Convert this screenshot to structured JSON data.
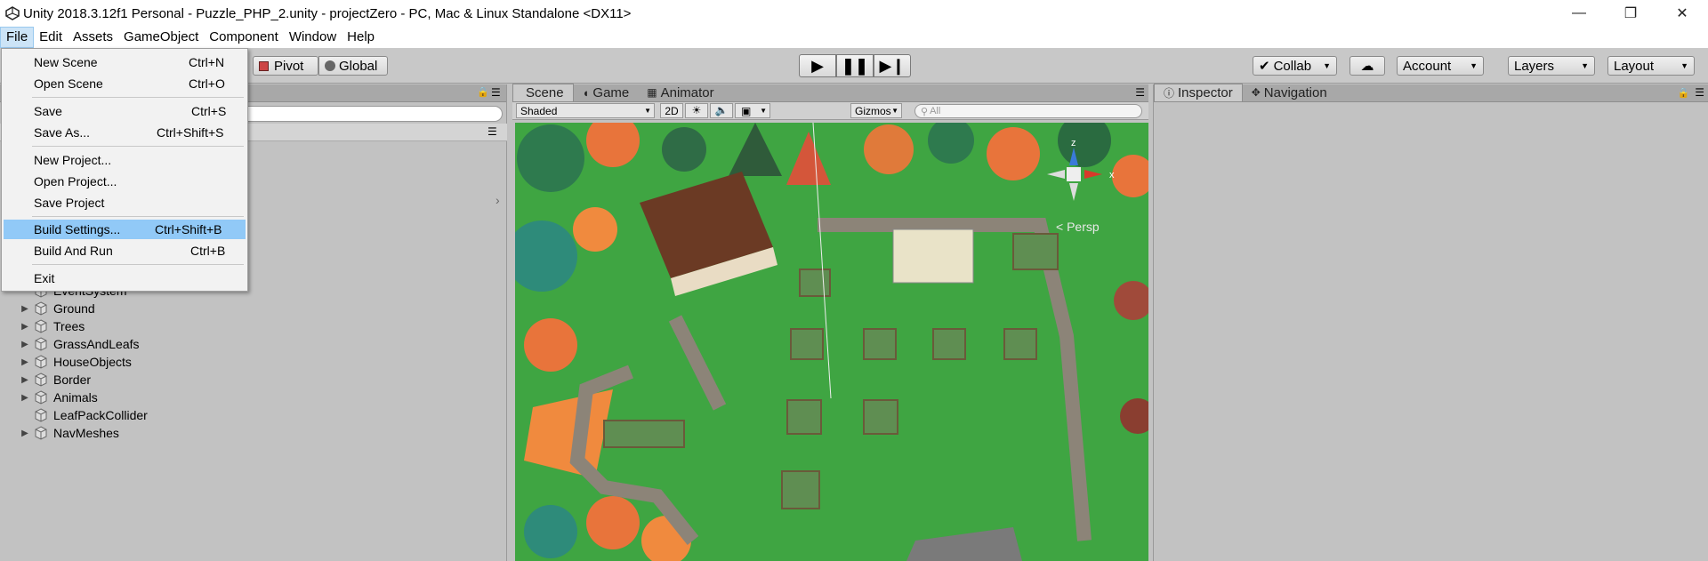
{
  "titlebar": {
    "title": "Unity 2018.3.12f1 Personal - Puzzle_PHP_2.unity - projectZero - PC, Mac & Linux Standalone <DX11>"
  },
  "menubar": {
    "items": [
      "File",
      "Edit",
      "Assets",
      "GameObject",
      "Component",
      "Window",
      "Help"
    ]
  },
  "toolbar": {
    "pivot": "Pivot",
    "global": "Global",
    "collab": "Collab",
    "account": "Account",
    "layers": "Layers",
    "layout": "Layout"
  },
  "file_menu": {
    "new_scene": {
      "label": "New Scene",
      "shortcut": "Ctrl+N"
    },
    "open_scene": {
      "label": "Open Scene",
      "shortcut": "Ctrl+O"
    },
    "save": {
      "label": "Save",
      "shortcut": "Ctrl+S"
    },
    "save_as": {
      "label": "Save As...",
      "shortcut": "Ctrl+Shift+S"
    },
    "new_project": {
      "label": "New Project..."
    },
    "open_project": {
      "label": "Open Project..."
    },
    "save_project": {
      "label": "Save Project"
    },
    "build_settings": {
      "label": "Build Settings...",
      "shortcut": "Ctrl+Shift+B"
    },
    "build_and_run": {
      "label": "Build And Run",
      "shortcut": "Ctrl+B"
    },
    "exit": {
      "label": "Exit"
    }
  },
  "hierarchy": {
    "items": [
      {
        "label": "EventSystem",
        "expandable": false
      },
      {
        "label": "Ground",
        "expandable": true
      },
      {
        "label": "Trees",
        "expandable": true
      },
      {
        "label": "GrassAndLeafs",
        "expandable": true
      },
      {
        "label": "HouseObjects",
        "expandable": true
      },
      {
        "label": "Border",
        "expandable": true
      },
      {
        "label": "Animals",
        "expandable": true
      },
      {
        "label": "LeafPackCollider",
        "expandable": false
      },
      {
        "label": "NavMeshes",
        "expandable": true
      }
    ]
  },
  "scene": {
    "tabs": [
      "Scene",
      "Game",
      "Animator"
    ],
    "shading": "Shaded",
    "mode_2d": "2D",
    "gizmos": "Gizmos",
    "search_placeholder": "All",
    "persp": "< Persp",
    "axis_z": "z",
    "axis_x": "x"
  },
  "inspector": {
    "tabs": [
      "Inspector",
      "Navigation"
    ]
  },
  "colors": {
    "menu_highlight": "#91c9f7",
    "grass": "#3fa542",
    "panel_bg": "#c2c2c2"
  }
}
